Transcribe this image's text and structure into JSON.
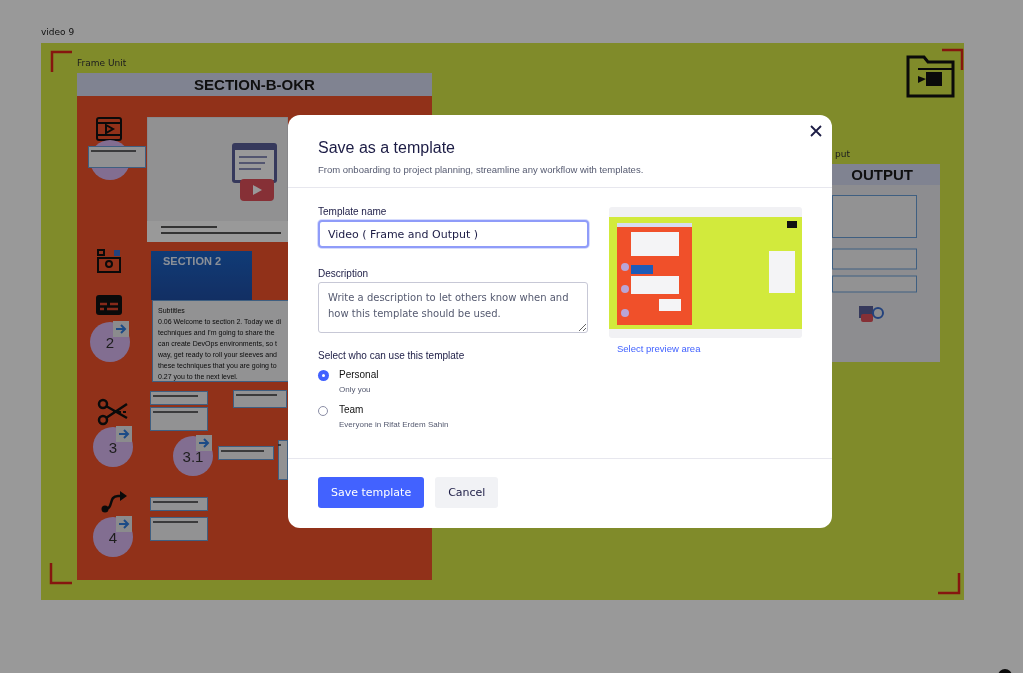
{
  "board": {
    "board_label": "video 9",
    "frame_label": "Frame Unit",
    "section_title": "SECTION-B-OKR",
    "slide_title": "SECTION 2",
    "subtitles": [
      "Subtitles",
      "0.06 Welcome to section 2. Today we di",
      "techniques and I'm going to share the",
      "can create DevOps environments, so t",
      "way, get ready to roll your sleeves and",
      "these techniques that you are going to",
      "0.27 you to the next level."
    ],
    "steps": [
      "2",
      "3",
      "3.1",
      "4"
    ],
    "output_label": "put",
    "output_title": "OUTPUT"
  },
  "dialog": {
    "title": "Save as a template",
    "subtitle": "From onboarding to project planning, streamline any workflow with templates.",
    "name_field": {
      "label": "Template name",
      "value": "Video ( Frame and Output )"
    },
    "description_field": {
      "label": "Description",
      "placeholder": "Write a description to let others know when and how this template should be used."
    },
    "preview_link": "Select preview area",
    "audience_label": "Select who can use this template",
    "options": [
      {
        "label": "Personal",
        "hint": "Only you",
        "selected": true
      },
      {
        "label": "Team",
        "hint": "Everyone in Rifat Erdem Sahin",
        "selected": false
      }
    ],
    "buttons": [
      {
        "label": "Save template",
        "kind": "primary"
      },
      {
        "label": "Cancel",
        "kind": "secondary"
      }
    ]
  }
}
